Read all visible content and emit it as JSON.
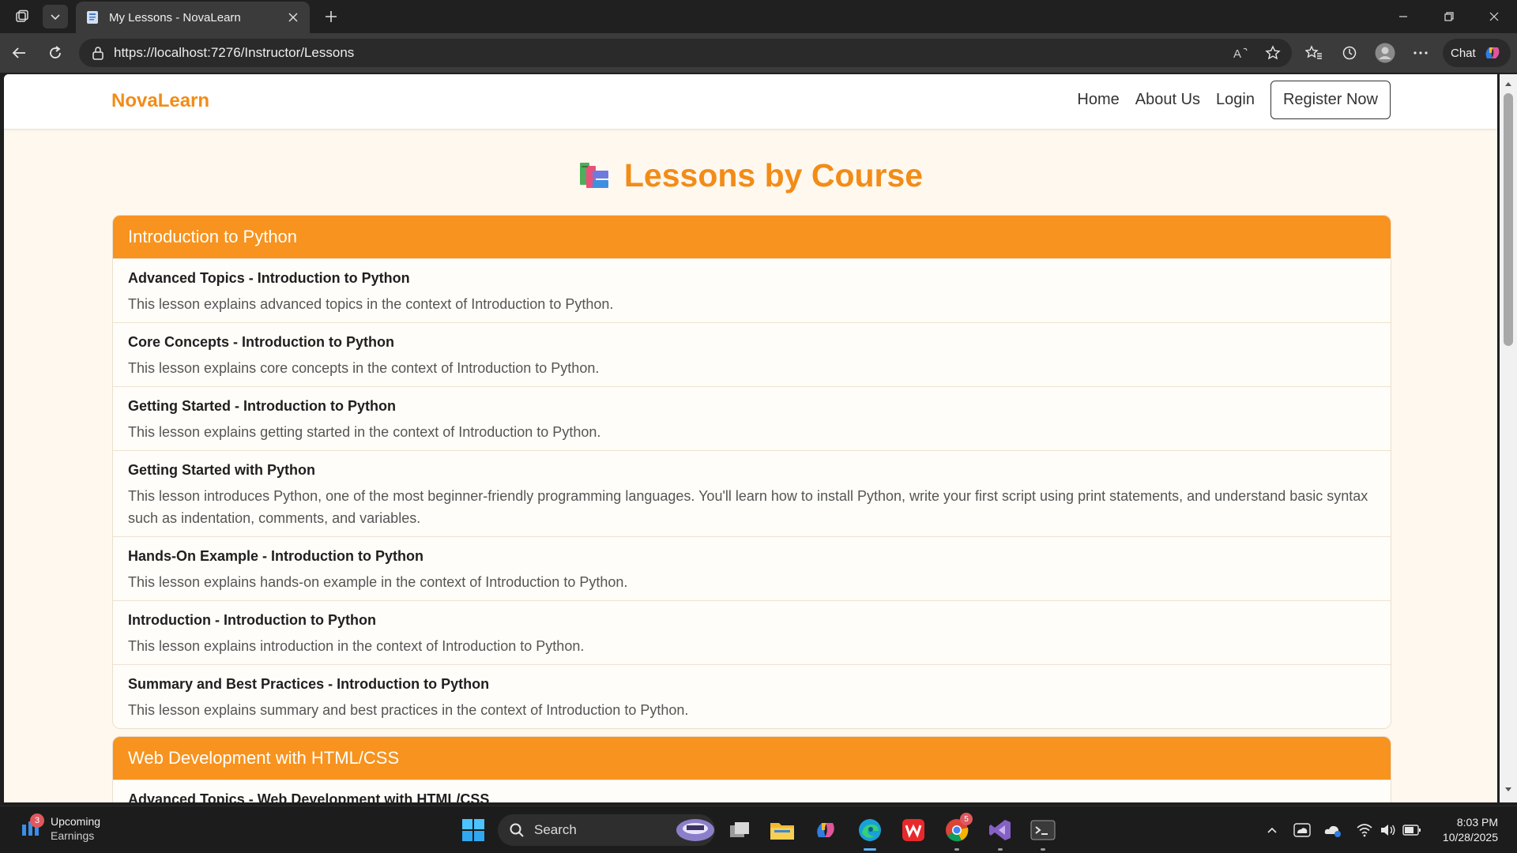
{
  "browser": {
    "tab_title": "My Lessons - NovaLearn",
    "url": "https://localhost:7276/Instructor/Lessons",
    "chat_label": "Chat"
  },
  "site": {
    "brand": "NovaLearn",
    "nav": {
      "home": "Home",
      "about": "About Us",
      "login": "Login",
      "register": "Register Now"
    },
    "page_title": "Lessons by Course",
    "title_icon": "books-emoji-icon"
  },
  "courses": [
    {
      "name": "Introduction to Python",
      "lessons": [
        {
          "title": "Advanced Topics - Introduction to Python",
          "desc": "This lesson explains advanced topics in the context of Introduction to Python."
        },
        {
          "title": "Core Concepts - Introduction to Python",
          "desc": "This lesson explains core concepts in the context of Introduction to Python."
        },
        {
          "title": "Getting Started - Introduction to Python",
          "desc": "This lesson explains getting started in the context of Introduction to Python."
        },
        {
          "title": "Getting Started with Python",
          "desc": "This lesson introduces Python, one of the most beginner-friendly programming languages. You'll learn how to install Python, write your first script using print statements, and understand basic syntax such as indentation, comments, and variables."
        },
        {
          "title": "Hands-On Example - Introduction to Python",
          "desc": "This lesson explains hands-on example in the context of Introduction to Python."
        },
        {
          "title": "Introduction - Introduction to Python",
          "desc": "This lesson explains introduction in the context of Introduction to Python."
        },
        {
          "title": "Summary and Best Practices - Introduction to Python",
          "desc": "This lesson explains summary and best practices in the context of Introduction to Python."
        }
      ]
    },
    {
      "name": "Web Development with HTML/CSS",
      "lessons": [
        {
          "title": "Advanced Topics - Web Development with HTML/CSS",
          "desc": ""
        }
      ]
    }
  ],
  "taskbar": {
    "widget_badge": "3",
    "widget_title": "Upcoming",
    "widget_sub": "Earnings",
    "search_label": "Search",
    "chrome_badge": "5",
    "time": "8:03 PM",
    "date": "10/28/2025"
  },
  "colors": {
    "accent": "#f7931e",
    "brand": "#f28c18",
    "page_bg": "#fff8ee"
  }
}
